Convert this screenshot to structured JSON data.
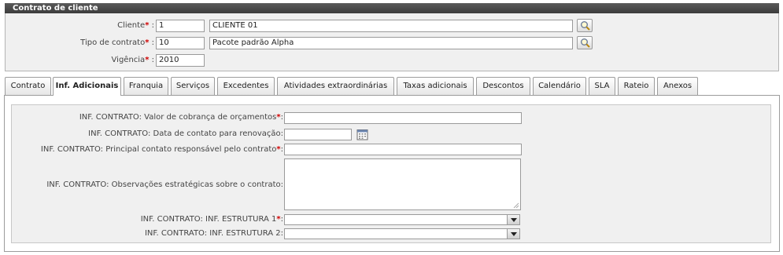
{
  "header": {
    "title": "Contrato de cliente",
    "cliente": {
      "label": "Cliente",
      "code": "1",
      "name": "CLIENTE 01"
    },
    "tipo": {
      "label": "Tipo de contrato",
      "code": "10",
      "name": "Pacote padrão Alpha"
    },
    "vigencia": {
      "label": "Vigência",
      "value": "2010"
    },
    "required_mark": "*",
    "colon": " :"
  },
  "tabs": [
    "Contrato",
    "Inf. Adicionais",
    "Franquia",
    "Serviços",
    "Excedentes",
    "Atividades extraordinárias",
    "Taxas adicionais",
    "Descontos",
    "Calendário",
    "SLA",
    "Rateio",
    "Anexos"
  ],
  "active_tab": "Inf. Adicionais",
  "form": {
    "f1": {
      "label": "INF. CONTRATO: Valor de cobrança de orçamentos",
      "required": true,
      "value": ""
    },
    "f2": {
      "label": "INF. CONTRATO: Data de contato para renovação:",
      "value": ""
    },
    "f3": {
      "label": "INF. CONTRATO: Principal contato responsável pelo contrato",
      "required": true,
      "value": ""
    },
    "f4": {
      "label": "INF. CONTRATO: Observações estratégicas sobre o contrato:",
      "value": ""
    },
    "f5": {
      "label": "INF. CONTRATO: INF. ESTRUTURA 1",
      "required": true,
      "value": ""
    },
    "f6": {
      "label": "INF. CONTRATO: INF. ESTRUTURA 2:",
      "value": ""
    }
  },
  "colors": {
    "required": "#d00000",
    "title_bar": "#4a4a4a",
    "panel_bg": "#f0f0f0"
  },
  "icons": {
    "search": "magnifier-icon",
    "calendar": "calendar-icon",
    "dropdown": "chevron-down-icon"
  }
}
